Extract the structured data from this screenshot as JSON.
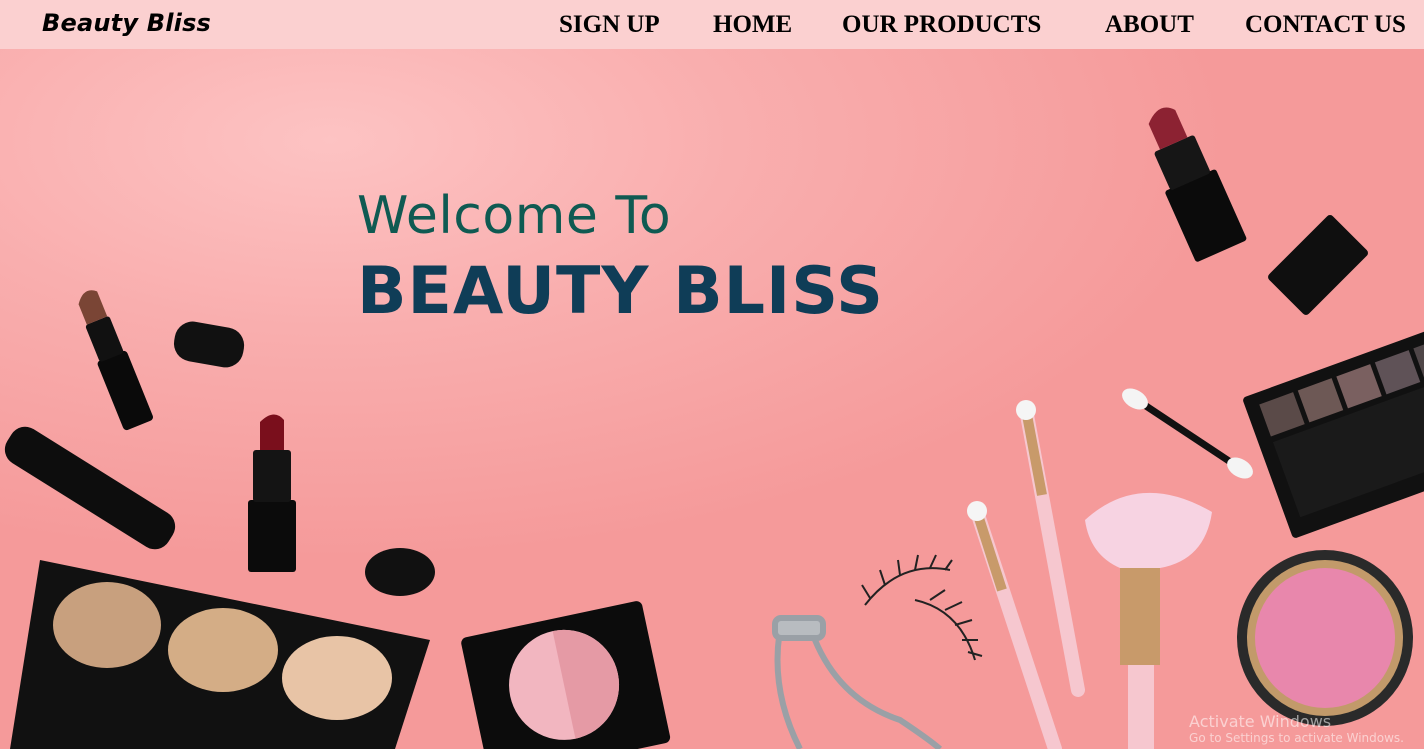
{
  "brand": {
    "name": "Beauty Bliss"
  },
  "nav": {
    "items": [
      {
        "label": "SIGN UP"
      },
      {
        "label": "HOME"
      },
      {
        "label": "OUR PRODUCTS"
      },
      {
        "label": "ABOUT"
      },
      {
        "label": "CONTACT US"
      }
    ]
  },
  "hero": {
    "welcome": "Welcome To",
    "title": "BEAUTY BLISS"
  },
  "watermark": {
    "title": "Activate Windows",
    "subtitle": "Go to Settings to activate Windows."
  },
  "colors": {
    "navbar_bg": "#fbd0d0",
    "hero_bg": "#f7a4a4",
    "welcome_text": "#0f5a52",
    "title_text": "#0f3d57"
  },
  "icons": [
    "lipstick-icon",
    "eyeshadow-palette-icon",
    "makeup-brush-icon",
    "eyelash-curler-icon",
    "blush-compact-icon",
    "false-eyelash-icon"
  ]
}
